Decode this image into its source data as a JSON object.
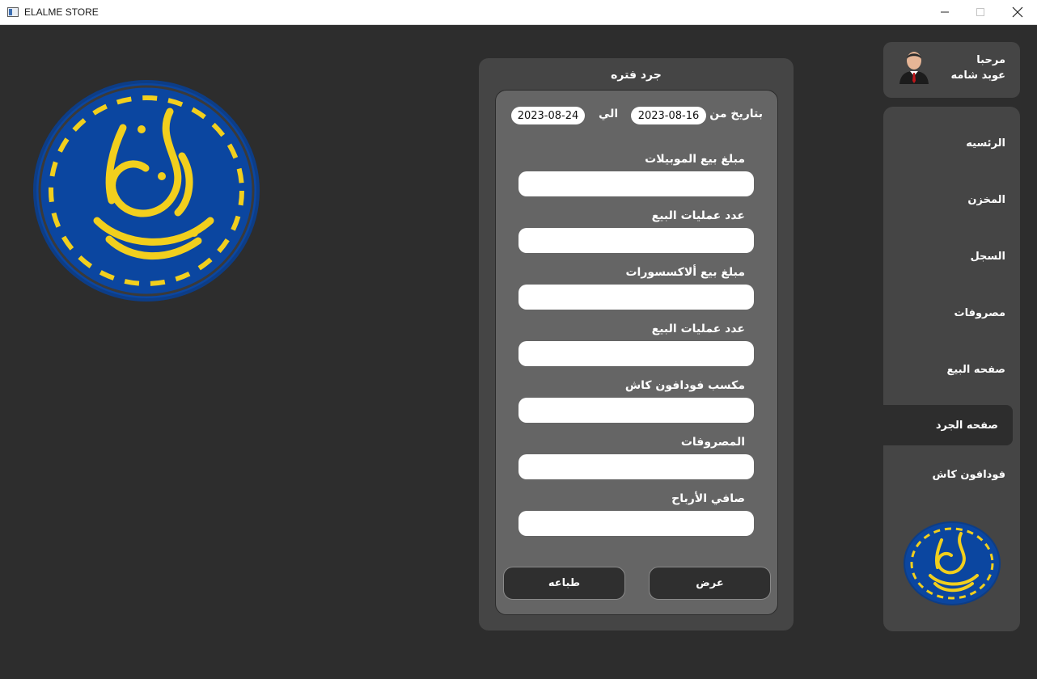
{
  "window": {
    "title": "ELALME STORE"
  },
  "report": {
    "title": "جرد فتره",
    "date_from_label": "بتاريخ من",
    "date_from": "2023-08-16",
    "date_to_label": "الي",
    "date_to": "2023-08-24",
    "fields": [
      {
        "label": "مبلغ بيع الموبيلات",
        "value": ""
      },
      {
        "label": "عدد عمليات البيع",
        "value": ""
      },
      {
        "label": "مبلغ بيع ألاكسسورات",
        "value": ""
      },
      {
        "label": "عدد عمليات البيع",
        "value": ""
      },
      {
        "label": "مكسب فودافون كاش",
        "value": ""
      },
      {
        "label": "المصروفات",
        "value": ""
      },
      {
        "label": "صافي الأرباح",
        "value": ""
      }
    ],
    "buttons": {
      "show": "عرض",
      "print": "طباعه"
    }
  },
  "user": {
    "greeting": "مرحبا",
    "name": "عوبد شامه"
  },
  "nav": {
    "items": [
      {
        "label": "الرئسيه",
        "active": false
      },
      {
        "label": "المخزن",
        "active": false
      },
      {
        "label": "السجل",
        "active": false
      },
      {
        "label": "مصروفات",
        "active": false
      },
      {
        "label": "صفحه البيع",
        "active": false
      },
      {
        "label": "صفحه الجرد",
        "active": true
      },
      {
        "label": "فودافون كاش",
        "active": false
      }
    ]
  },
  "colors": {
    "background": "#2d2d2d",
    "panel": "#454545",
    "inner_panel": "#656565",
    "logo_blue": "#0b46a0",
    "logo_gold": "#f2cf1d"
  },
  "icons": {
    "logo": "store-logo-seal",
    "avatar": "user-avatar-icon"
  }
}
